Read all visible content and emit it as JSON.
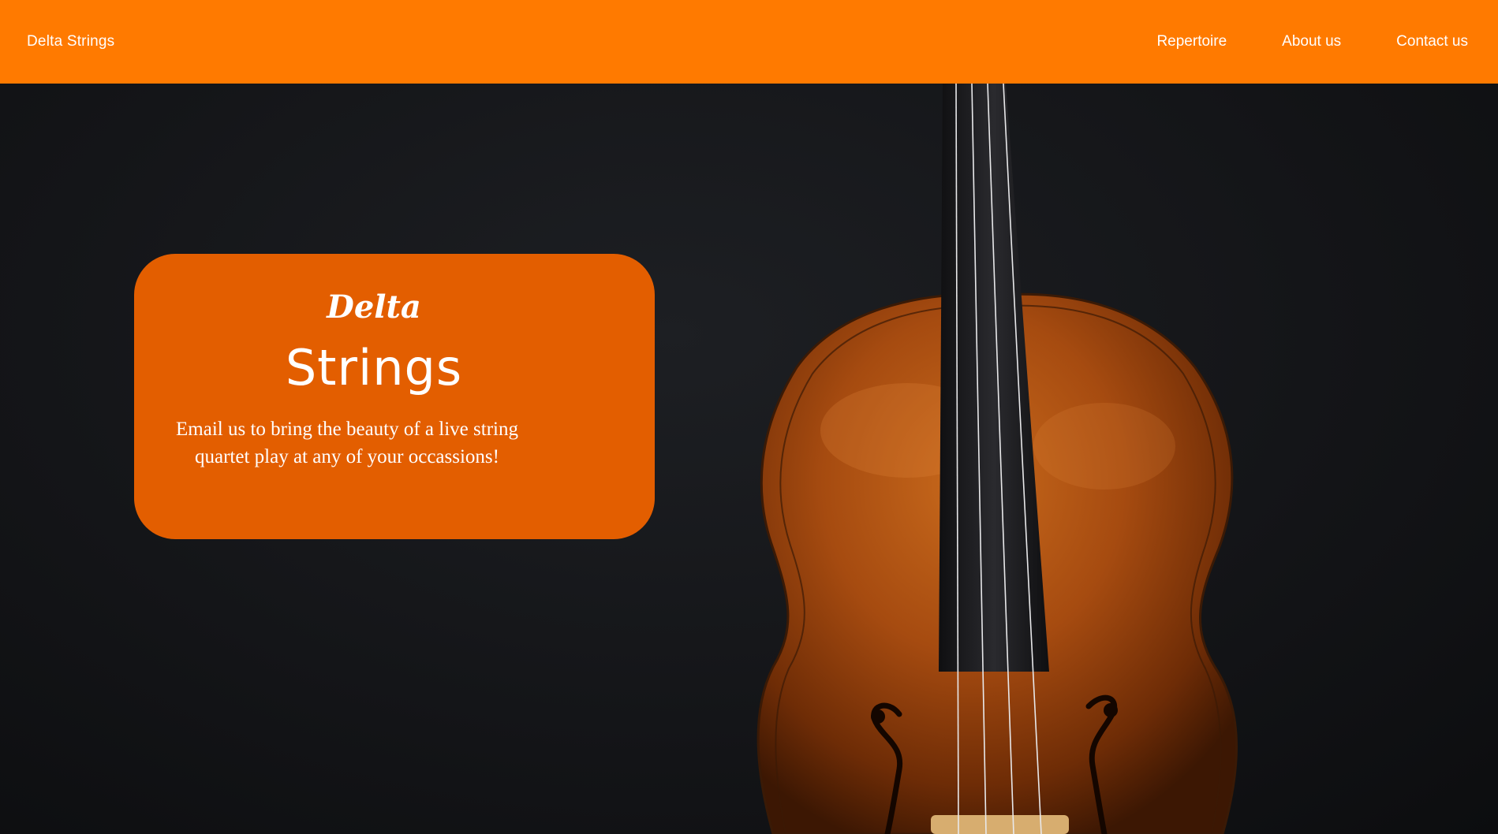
{
  "navbar": {
    "brand": "Delta Strings",
    "links": [
      {
        "label": "Repertoire"
      },
      {
        "label": "About us"
      },
      {
        "label": "Contact us"
      }
    ]
  },
  "hero": {
    "script_title": "Delta",
    "title": "Strings",
    "tagline": "Email us to bring the beauty of a live string quartet play at any of your occassions!"
  },
  "colors": {
    "navbar_bg": "#ff7a00",
    "card_bg": "#e35e00",
    "page_bg": "#131416",
    "violin_wood": "#a4490f",
    "fingerboard": "#1b1b1d"
  },
  "images": {
    "violin": "violin-image"
  }
}
